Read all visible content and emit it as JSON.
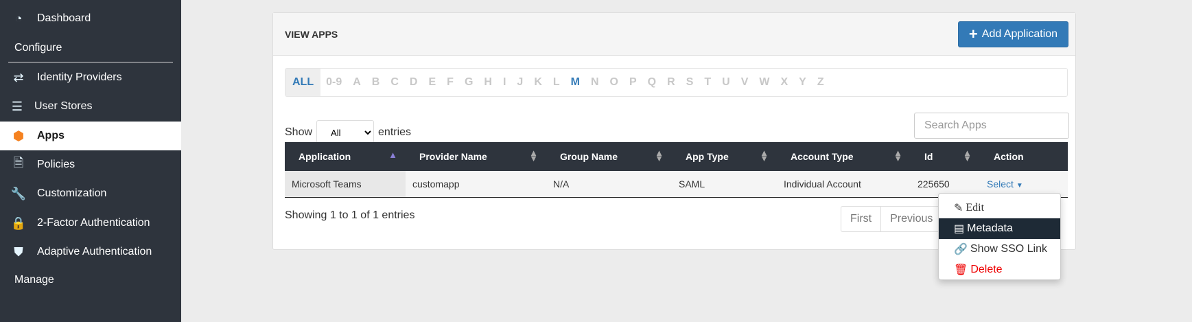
{
  "sidebar": {
    "items": [
      {
        "label": "Dashboard",
        "icon": "dashboard-icon"
      },
      {
        "label": "Identity Providers",
        "icon": "exchange-icon"
      },
      {
        "label": "User Stores",
        "icon": "database-icon"
      },
      {
        "label": "Apps",
        "icon": "cube-icon",
        "active": true
      },
      {
        "label": "Policies",
        "icon": "document-icon"
      },
      {
        "label": "Customization",
        "icon": "wrench-icon"
      },
      {
        "label": "2-Factor Authentication",
        "icon": "lock-icon"
      },
      {
        "label": "Adaptive Authentication",
        "icon": "shield-icon"
      }
    ],
    "sections": {
      "configure": "Configure",
      "manage": "Manage"
    }
  },
  "card": {
    "title": "VIEW APPS",
    "add_button": "Add Application",
    "add_icon": "plus-icon"
  },
  "alphabet": [
    "ALL",
    "0-9",
    "A",
    "B",
    "C",
    "D",
    "E",
    "F",
    "G",
    "H",
    "I",
    "J",
    "K",
    "L",
    "M",
    "N",
    "O",
    "P",
    "Q",
    "R",
    "S",
    "T",
    "U",
    "V",
    "W",
    "X",
    "Y",
    "Z"
  ],
  "alphabet_selected": "M",
  "show": {
    "prefix": "Show",
    "value": "All",
    "suffix": "entries"
  },
  "search": {
    "placeholder": "Search Apps"
  },
  "table": {
    "columns": [
      "Application",
      "Provider Name",
      "Group Name",
      "App Type",
      "Account Type",
      "Id",
      "Action"
    ],
    "rows": [
      {
        "application": "Microsoft Teams",
        "provider": "customapp",
        "group": "N/A",
        "type": "SAML",
        "account": "Individual Account",
        "id": "225650",
        "action": "Select"
      }
    ]
  },
  "info": "Showing 1 to 1 of 1 entries",
  "pager": {
    "first": "First",
    "previous": "Previous"
  },
  "dropdown": {
    "items": [
      {
        "label": "Edit",
        "icon": "edit-icon"
      },
      {
        "label": "Metadata",
        "icon": "table-icon"
      },
      {
        "label": "Show SSO Link",
        "icon": "link-icon"
      },
      {
        "label": "Delete",
        "icon": "trash-icon"
      }
    ]
  },
  "colors": {
    "sidebar": "#2e343d",
    "accent": "#337ab7",
    "active_icon": "#f58220",
    "delete": "#ee0000"
  }
}
